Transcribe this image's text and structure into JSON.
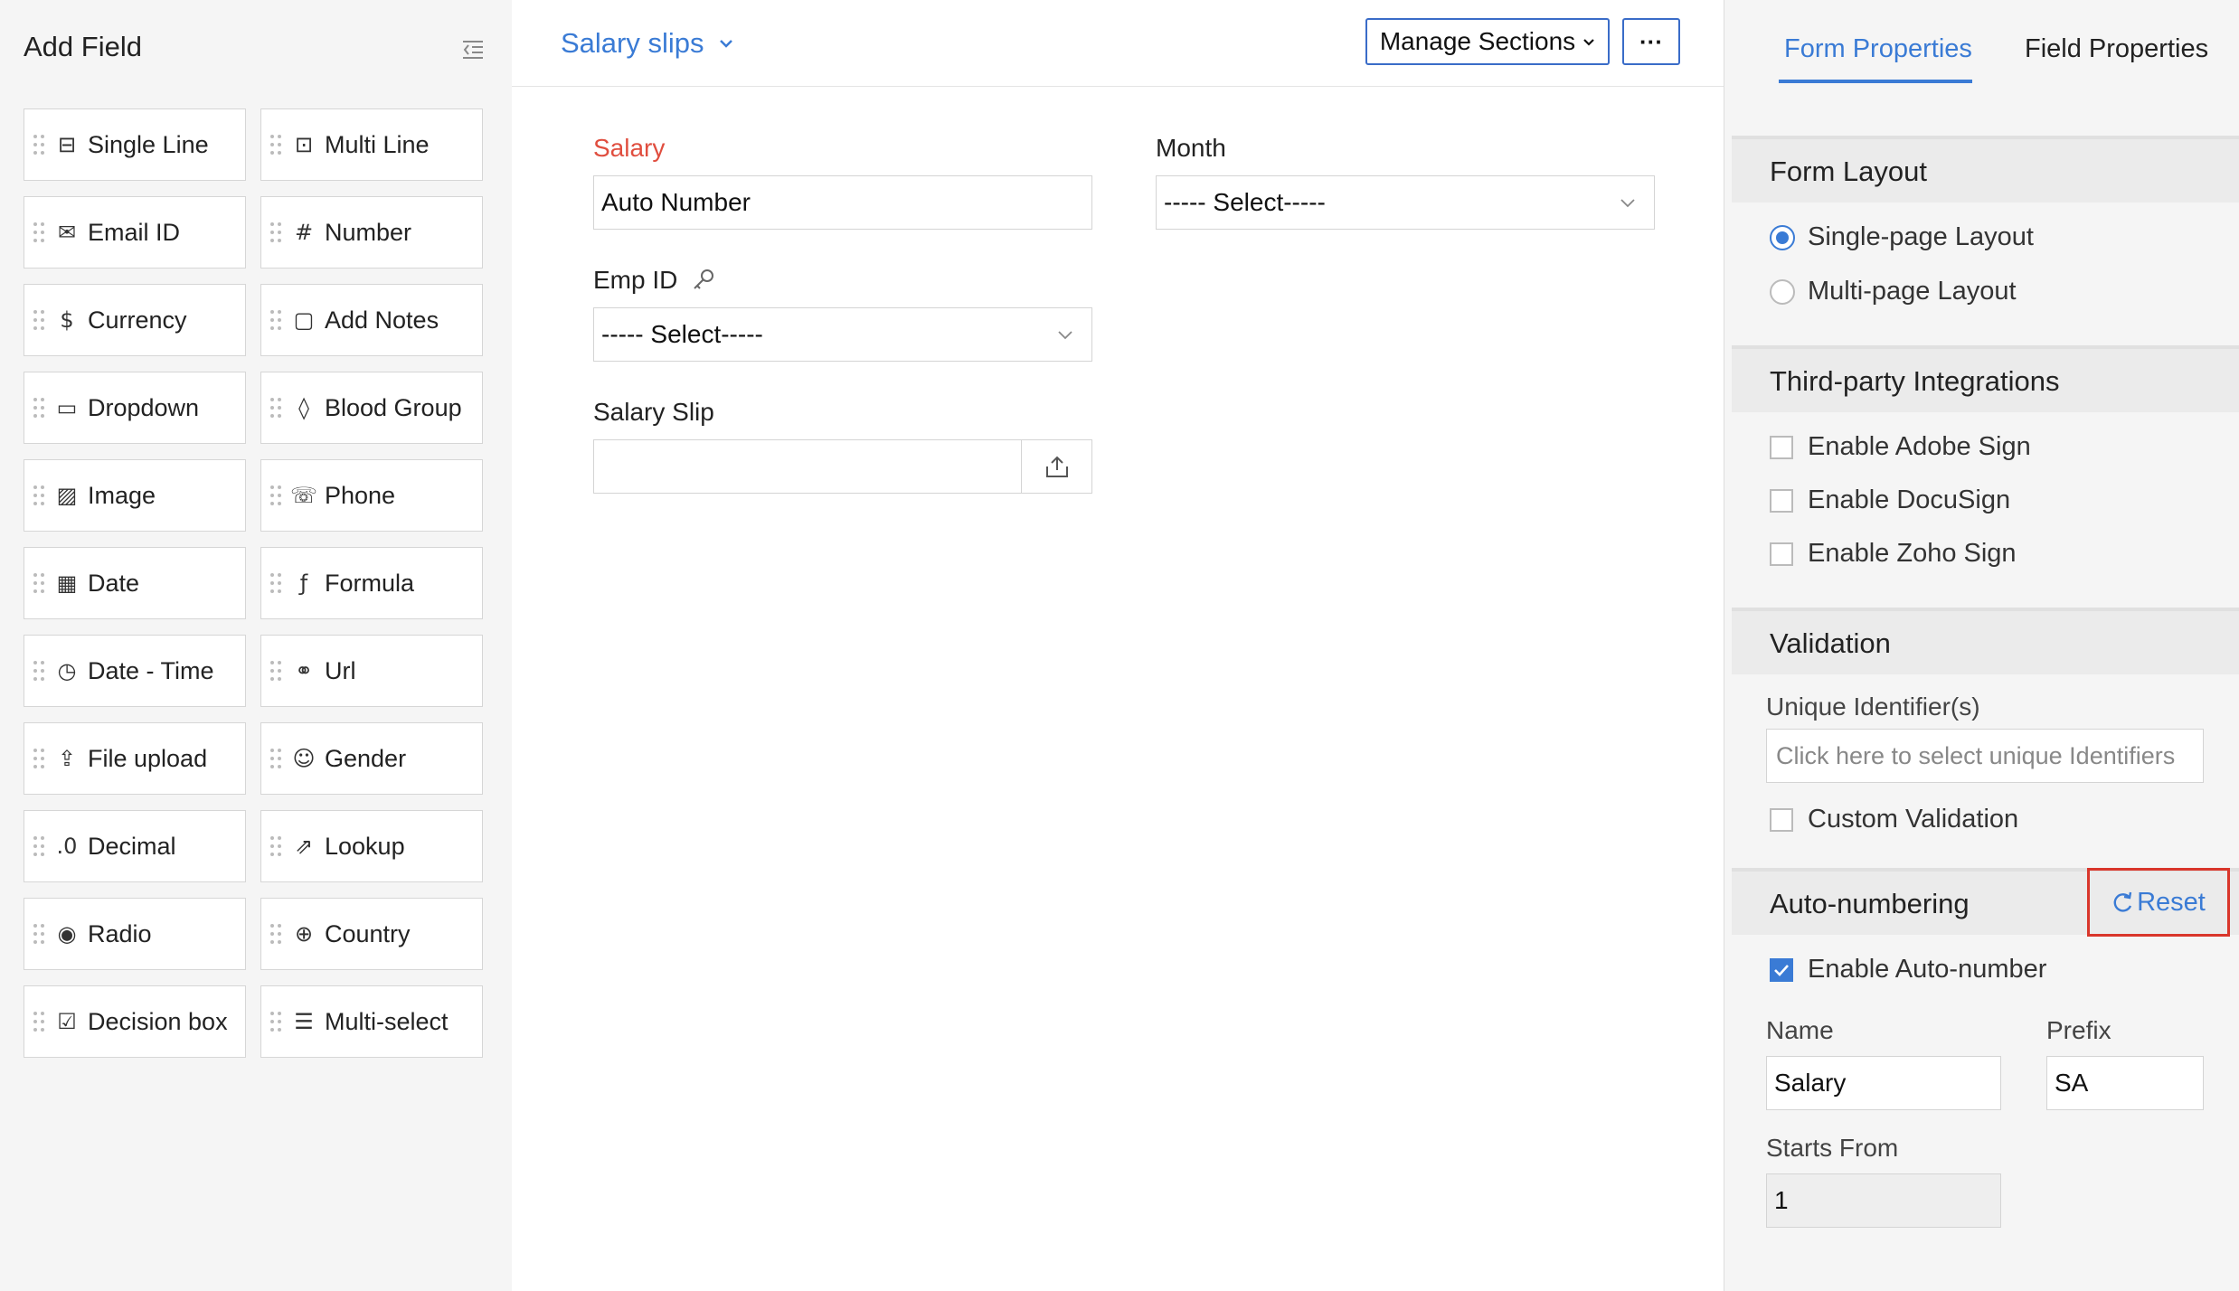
{
  "left_panel": {
    "title": "Add Field",
    "fields": [
      {
        "label": "Single Line",
        "icon": "single-line-icon"
      },
      {
        "label": "Multi Line",
        "icon": "multi-line-icon"
      },
      {
        "label": "Email ID",
        "icon": "email-icon"
      },
      {
        "label": "Number",
        "icon": "number-icon"
      },
      {
        "label": "Currency",
        "icon": "currency-icon"
      },
      {
        "label": "Add Notes",
        "icon": "notes-icon"
      },
      {
        "label": "Dropdown",
        "icon": "dropdown-icon"
      },
      {
        "label": "Blood Group",
        "icon": "blood-drop-icon"
      },
      {
        "label": "Image",
        "icon": "image-icon"
      },
      {
        "label": "Phone",
        "icon": "phone-icon"
      },
      {
        "label": "Date",
        "icon": "calendar-icon"
      },
      {
        "label": "Formula",
        "icon": "formula-icon"
      },
      {
        "label": "Date - Time",
        "icon": "date-time-icon"
      },
      {
        "label": "Url",
        "icon": "link-icon"
      },
      {
        "label": "File upload",
        "icon": "upload-icon"
      },
      {
        "label": "Gender",
        "icon": "person-icon"
      },
      {
        "label": "Decimal",
        "icon": "decimal-icon"
      },
      {
        "label": "Lookup",
        "icon": "lookup-icon"
      },
      {
        "label": "Radio",
        "icon": "radio-icon"
      },
      {
        "label": "Country",
        "icon": "globe-icon"
      },
      {
        "label": "Decision box",
        "icon": "checkbox-icon"
      },
      {
        "label": "Multi-select",
        "icon": "multi-select-icon"
      }
    ]
  },
  "header": {
    "form_name": "Salary slips",
    "manage_sections": "Manage Sections",
    "more": "···"
  },
  "form": {
    "salary_label": "Salary",
    "salary_value": "Auto Number",
    "month_label": "Month",
    "month_value": "----- Select-----",
    "emp_id_label": "Emp ID",
    "emp_id_value": "----- Select-----",
    "salary_slip_label": "Salary Slip"
  },
  "right_panel": {
    "tabs": [
      "Form Properties",
      "Field Properties"
    ],
    "form_layout": {
      "title": "Form Layout",
      "options": [
        "Single-page Layout",
        "Multi-page Layout"
      ],
      "selected": "Single-page Layout"
    },
    "integrations": {
      "title": "Third-party Integrations",
      "options": [
        "Enable Adobe Sign",
        "Enable DocuSign",
        "Enable Zoho Sign"
      ]
    },
    "validation": {
      "title": "Validation",
      "unique_label": "Unique Identifier(s)",
      "unique_placeholder": "Click here to select unique Identifiers",
      "custom_validation": "Custom Validation"
    },
    "auto_numbering": {
      "title": "Auto-numbering",
      "reset": "Reset",
      "enable_label": "Enable Auto-number",
      "enabled": true,
      "name_label": "Name",
      "name_value": "Salary",
      "prefix_label": "Prefix",
      "prefix_value": "SA",
      "starts_from_label": "Starts From",
      "starts_from_value": "1"
    }
  },
  "colors": {
    "accent": "#3a7bd5",
    "required": "#e04e3f",
    "highlight_box": "#d9362b"
  }
}
